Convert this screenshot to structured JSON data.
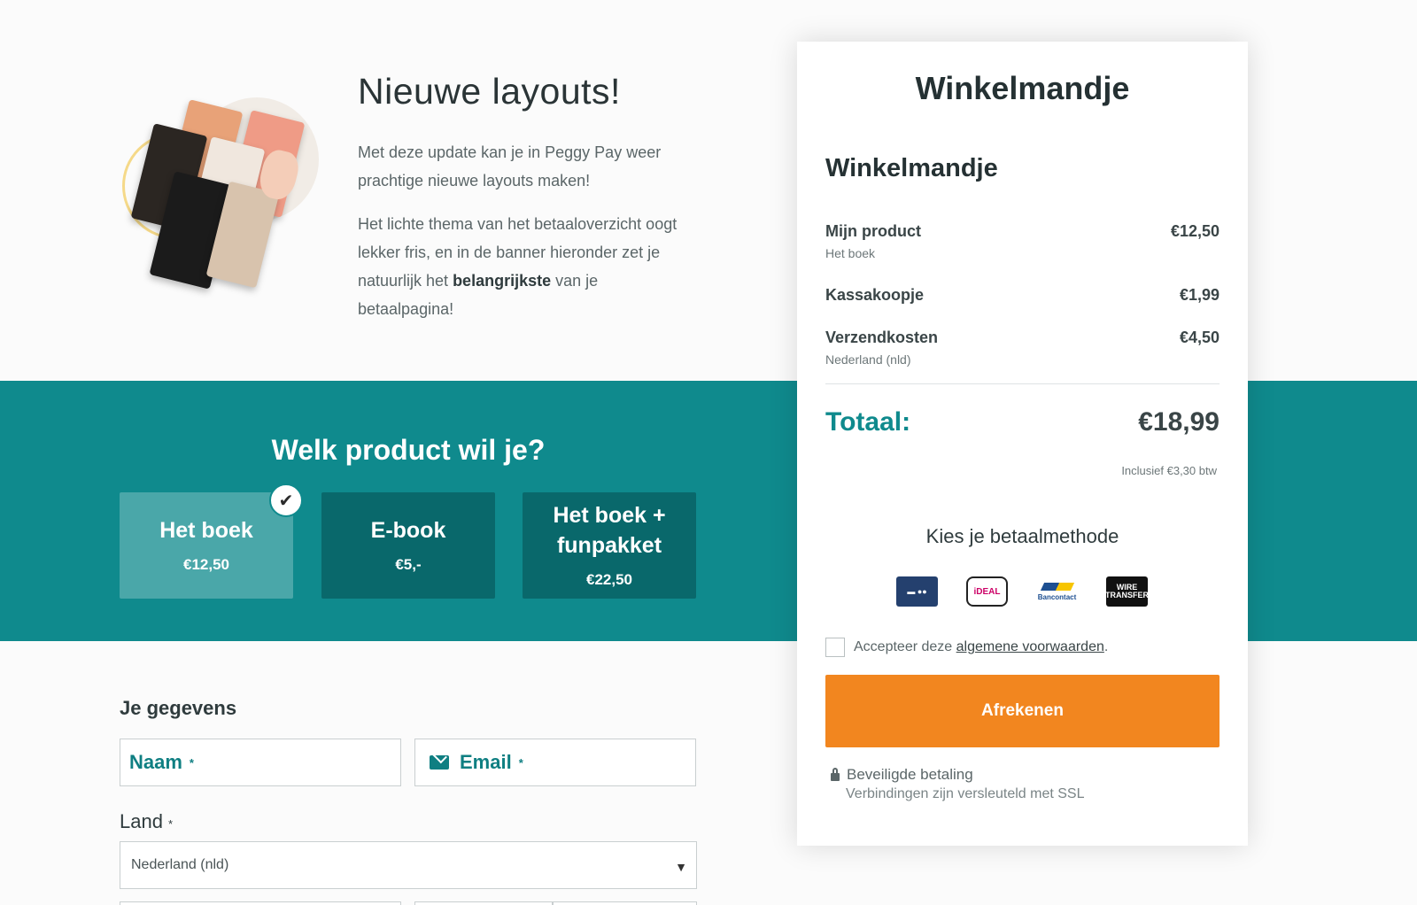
{
  "intro": {
    "title": "Nieuwe layouts!",
    "paragraph1": "Met deze update kan je in Peggy Pay weer prachtige nieuwe layouts maken!",
    "paragraph2_before": "Het lichte thema van het betaaloverzicht oogt lekker fris, en in de banner hieronder zet je natuurlijk het ",
    "paragraph2_bold": "belangrijkste",
    "paragraph2_after": " van je betaalpagina!"
  },
  "product_picker": {
    "title": "Welk product wil je?",
    "options": [
      {
        "name": "Het boek",
        "price": "€12,50",
        "selected": true
      },
      {
        "name": "E-book",
        "price": "€5,-",
        "selected": false
      },
      {
        "name": "Het boek + funpakket",
        "price": "€22,50",
        "selected": false
      }
    ]
  },
  "form": {
    "title": "Je gegevens",
    "name_label": "Naam",
    "email_label": "Email",
    "required_mark": "*",
    "country_label": "Land",
    "country_value": "Nederland (nld)"
  },
  "cart": {
    "title": "Winkelmandje",
    "subtitle": "Winkelmandje",
    "lines": [
      {
        "label": "Mijn product",
        "sub": "Het boek",
        "amount": "€12,50"
      },
      {
        "label": "Kassakoopje",
        "sub": "",
        "amount": "€1,99"
      },
      {
        "label": "Verzendkosten",
        "sub": "Nederland (nld)",
        "amount": "€4,50"
      }
    ],
    "total_label": "Totaal:",
    "total_amount": "€18,99",
    "vat_note": "Inclusief €3,30 btw",
    "payment_title": "Kies je betaalmethode",
    "payment_methods": {
      "bancontact": "Bancontact",
      "ideal": "iDEAL",
      "wire": "WIRE TRANSFER"
    },
    "terms_prefix": "Accepteer deze ",
    "terms_link": "algemene voorwaarden",
    "terms_suffix": ".",
    "checkout_label": "Afrekenen",
    "secure_title": "Beveiligde betaling",
    "secure_sub": "Verbindingen zijn versleuteld met SSL"
  },
  "colors": {
    "teal": "#0f8a8d",
    "teal_dark": "#09686b",
    "orange": "#f2861f"
  }
}
